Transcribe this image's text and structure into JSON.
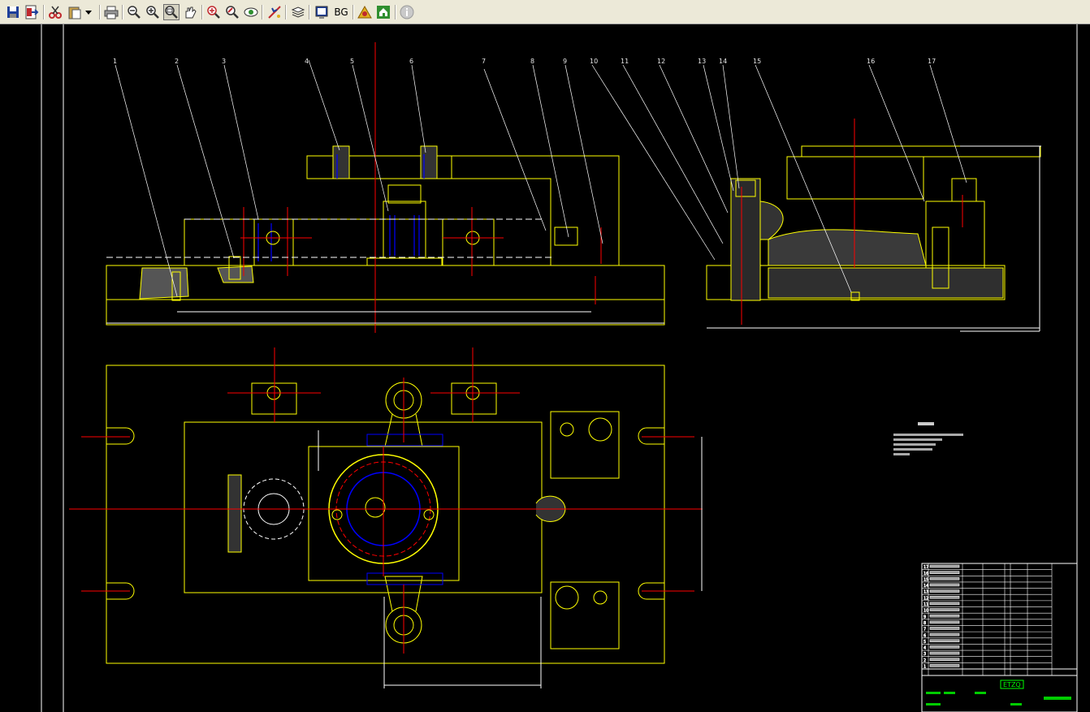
{
  "toolbar": {
    "bg_label": "BG",
    "colors": {
      "face": "#ece9d8",
      "pressed": "#d6d3c2"
    }
  },
  "drawing": {
    "colors": {
      "background": "#000000",
      "outline": "#ffff00",
      "centerline": "#ff0000",
      "hidden": "#0000ff",
      "leader": "#ffffff",
      "title": "#00ff00"
    },
    "part_numbers": [
      "1",
      "2",
      "3",
      "4",
      "5",
      "6",
      "7",
      "8",
      "9",
      "10",
      "11",
      "12",
      "13",
      "14",
      "15",
      "16",
      "17"
    ],
    "bom_rows": [
      "17",
      "16",
      "15",
      "14",
      "13",
      "12",
      "11",
      "10",
      "9",
      "8",
      "7",
      "6",
      "5",
      "4",
      "3",
      "2",
      "1"
    ],
    "title_code": "ETZQ"
  }
}
